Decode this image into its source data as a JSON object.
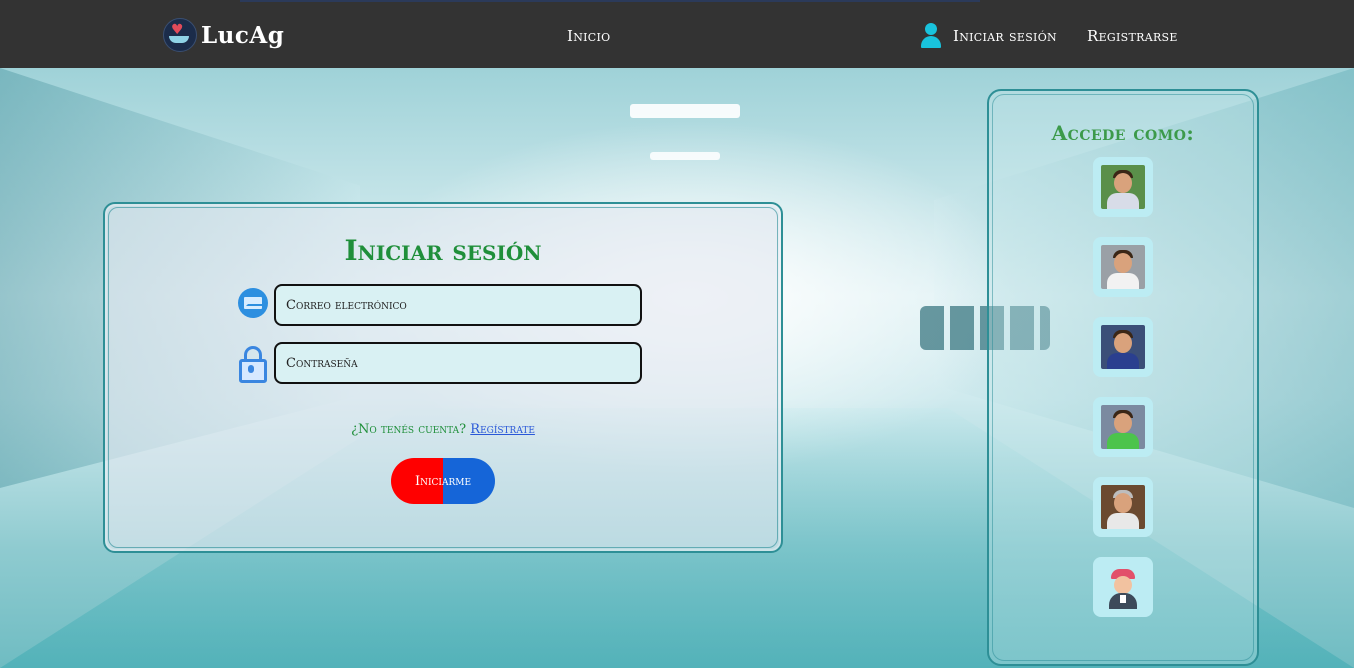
{
  "nav": {
    "brand": "LucAg",
    "logo_icon": "heart-hand-logo-icon",
    "links": {
      "inicio": "Inicio",
      "login": "Iniciar sesión",
      "register": "Registrarse"
    },
    "user_icon": "user-icon"
  },
  "login": {
    "title": "Iniciar sesión",
    "email_placeholder": "Correo electrónico",
    "password_placeholder": "Contraseña",
    "email_icon": "mail-icon",
    "password_icon": "lock-icon",
    "no_account_text": "¿No tenés cuenta?",
    "register_link": "Regístrate",
    "submit_label": "Iniciarme"
  },
  "side_panel": {
    "title": "Accede como:",
    "avatars": [
      {
        "name": "avatar-user-1",
        "icon": "person-photo-icon"
      },
      {
        "name": "avatar-user-2",
        "icon": "person-photo-icon"
      },
      {
        "name": "avatar-user-3",
        "icon": "person-photo-icon"
      },
      {
        "name": "avatar-user-4",
        "icon": "person-photo-icon"
      },
      {
        "name": "avatar-user-5",
        "icon": "person-photo-icon"
      },
      {
        "name": "avatar-user-6",
        "icon": "woman-cartoon-icon"
      }
    ]
  },
  "colors": {
    "navbar": "#333333",
    "accent_green": "#1f8f3a",
    "link_blue": "#2a58d8",
    "button_red": "#ff0000",
    "button_blue": "#1565d8",
    "border_teal": "#2e8f96"
  }
}
